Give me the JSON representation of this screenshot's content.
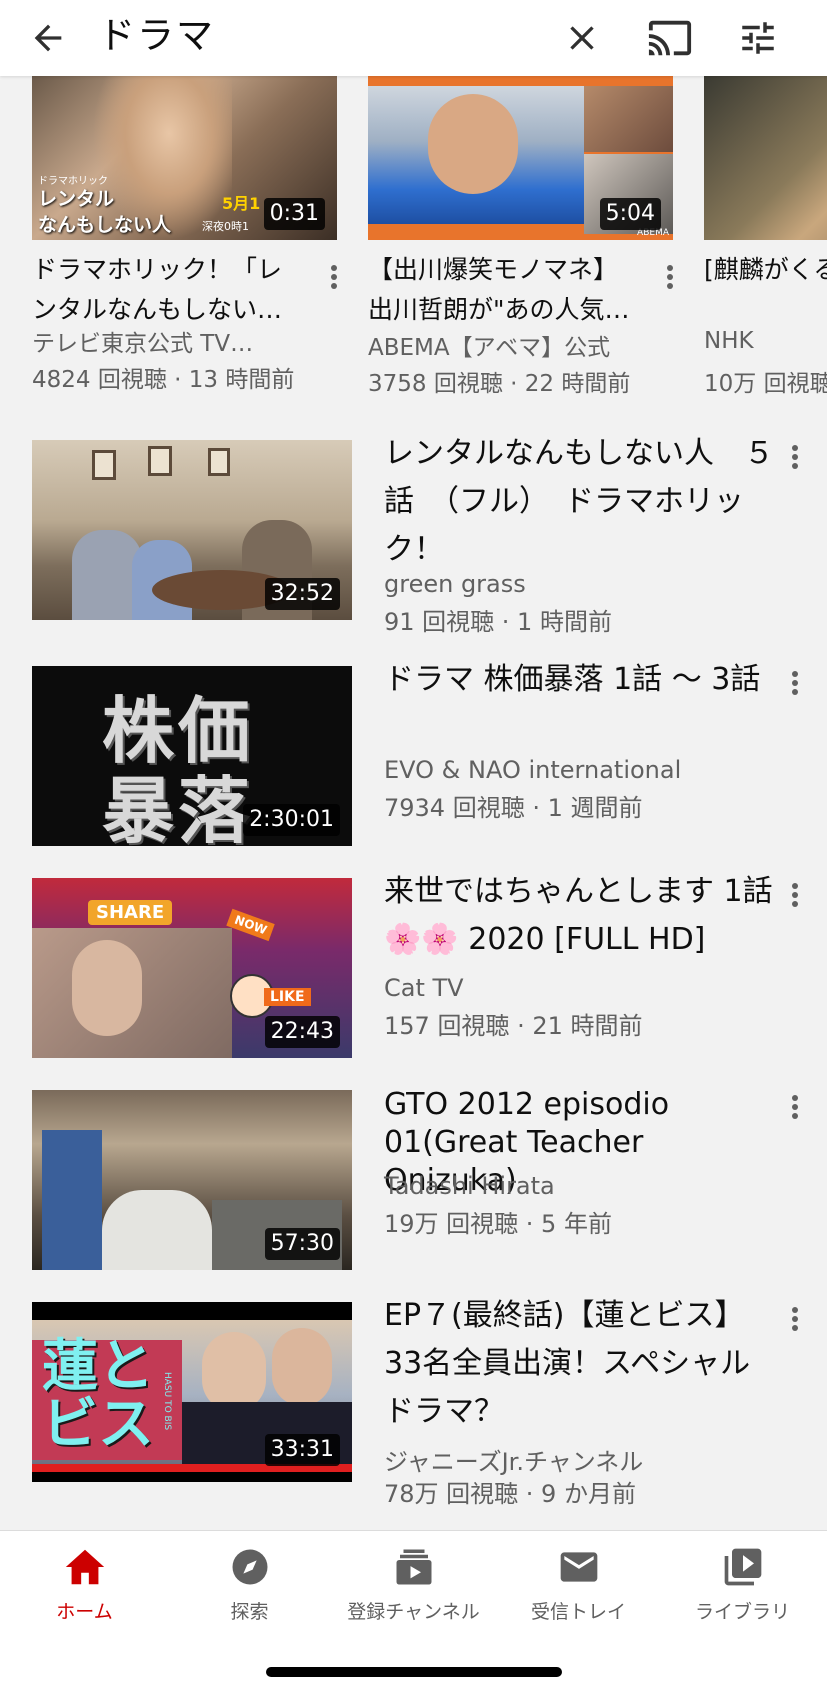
{
  "header": {
    "query": "ドラマ",
    "icons": [
      "back-arrow-icon",
      "close-icon",
      "cast-icon",
      "filter-sliders-icon"
    ]
  },
  "shelf": [
    {
      "title": "ドラマホリック！「レンタルなんもしない…",
      "channel": "テレビ東京公式 TV…",
      "meta": "4824 回視聴 · 13 時間前",
      "duration": "0:31",
      "thumb_text": {
        "tag": "ドラマホリック",
        "line1": "レンタル",
        "line2": "なんもしない人",
        "date": "5月1",
        "time": "深夜0時1"
      }
    },
    {
      "title": "【出川爆笑モノマネ】出川哲朗が\"あの人気…",
      "channel": "ABEMA【アベマ】公式",
      "meta": "3758 回視聴 · 22 時間前",
      "duration": "5:04",
      "thumb_text": {
        "brand": "ABEMA"
      }
    },
    {
      "title": "[麒麟がくるとめ | 大き",
      "channel": "NHK",
      "meta": "10万 回視聴",
      "duration": ""
    }
  ],
  "results": [
    {
      "title": "レンタルなんもしない人　５話　（フル）　ドラマホリック！",
      "channel": "green grass",
      "meta": "91 回視聴 · 1 時間前",
      "duration": "32:52"
    },
    {
      "title": "ドラマ  株価暴落  1話 ～ 3話",
      "channel": "EVO & NAO international",
      "meta": "7934 回視聴 · 1 週間前",
      "duration": "2:30:01",
      "thumb_text": {
        "line1": "株価",
        "line2": "暴落"
      }
    },
    {
      "title": "来世ではちゃんとします 1話 🌸🌸 2020 [FULL HD]",
      "channel": "Cat TV",
      "meta": "157 回視聴 · 21 時間前",
      "duration": "22:43",
      "thumb_text": {
        "share": "SHARE",
        "now": "NOW",
        "like": "LIKE"
      }
    },
    {
      "title": "GTO 2012 episodio 01(Great Teacher Onizuka)",
      "channel": "Tadashi Hirata",
      "meta": "19万 回視聴 · 5 年前",
      "duration": "57:30"
    },
    {
      "title": "EP７(最終話)【蓮とビス】33名全員出演！スペシャルドラマ？",
      "channel": "ジャニーズJr.チャンネル",
      "meta": "78万 回視聴 · 9 か月前",
      "duration": "33:31",
      "thumb_text": {
        "line1": "蓮と",
        "line2": "ビス",
        "sub": "HASU TO BIS"
      }
    }
  ],
  "bottom_nav": [
    {
      "label": "ホーム",
      "icon": "home-icon",
      "active": true
    },
    {
      "label": "探索",
      "icon": "compass-icon",
      "active": false
    },
    {
      "label": "登録チャンネル",
      "icon": "subscriptions-icon",
      "active": false
    },
    {
      "label": "受信トレイ",
      "icon": "mail-icon",
      "active": false
    },
    {
      "label": "ライブラリ",
      "icon": "library-icon",
      "active": false
    }
  ],
  "colors": {
    "accent": "#cc0000",
    "secondary_text": "#606060",
    "background": "#f2f2f2"
  }
}
